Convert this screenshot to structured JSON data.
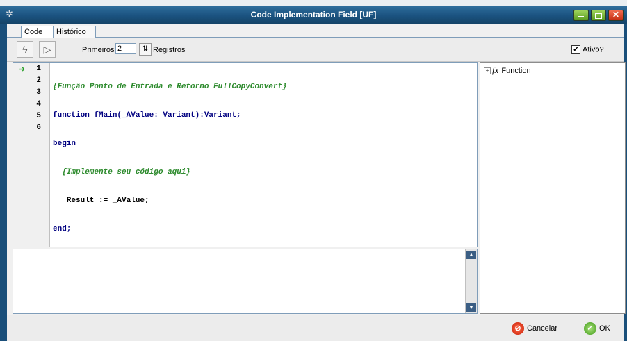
{
  "window": {
    "title": "Code Implementation Field [UF]"
  },
  "tabs": [
    {
      "label": "Code",
      "active": true
    },
    {
      "label": "Histórico",
      "active": false
    }
  ],
  "toolbar": {
    "primeiros_label": "Primeiros:",
    "primeiros_value": "2",
    "registros_label": "Registros",
    "ativo_label": "Ativo?",
    "ativo_checked": true
  },
  "editor": {
    "lines": [
      {
        "n": "1",
        "text": "{Função Ponto de Entrada e Retorno FullCopyConvert}"
      },
      {
        "n": "2",
        "text": "function fMain(_AValue: Variant):Variant;"
      },
      {
        "n": "3",
        "text": "begin"
      },
      {
        "n": "4",
        "text": "  {Implemente seu código aqui}"
      },
      {
        "n": "5",
        "text": "   Result := _AValue;"
      },
      {
        "n": "6",
        "text": "end;"
      }
    ]
  },
  "tree": {
    "items": [
      {
        "label": "Function"
      }
    ]
  },
  "footer": {
    "cancel_label": "Cancelar",
    "ok_label": "OK"
  },
  "colors": {
    "titlebar": "#1b5380",
    "comment": "#2e8b2e",
    "keyword": "#000080"
  }
}
